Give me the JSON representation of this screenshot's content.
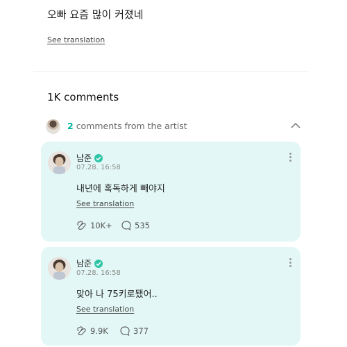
{
  "post": {
    "text": "오빠 요즘 많이 커졌네",
    "see_translation": "See translation"
  },
  "comments_header": {
    "title": "1K comments",
    "artist_count": "2",
    "artist_label": "comments from the artist"
  },
  "comments": [
    {
      "name": "남준",
      "date": "07.28. 16:58",
      "text": "내년에 혹독하게 빼야지",
      "see_translation": "See translation",
      "likes": "10K+",
      "replies": "535"
    },
    {
      "name": "남준",
      "date": "07.28. 16:58",
      "text": "맞아 나 75키로됐어..",
      "see_translation": "See translation",
      "likes": "9.9K",
      "replies": "377"
    }
  ],
  "colors": {
    "accent": "#00b5a0",
    "card_bg": "#e3f8f6",
    "verified": "#2ec4a6"
  },
  "icons": {
    "verified": "verified-badge-icon",
    "like": "heart-hands-icon",
    "reply": "speech-bubble-icon",
    "more": "more-vertical-icon",
    "collapse": "chevron-up-icon"
  }
}
